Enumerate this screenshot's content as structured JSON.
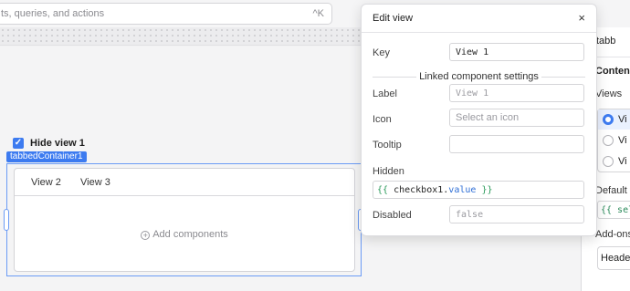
{
  "search": {
    "placeholder": "ts, queries, and actions",
    "shortcut": "^K"
  },
  "canvas": {
    "checkbox": {
      "label": "Hide view 1",
      "checked": true
    },
    "component_tag": "tabbedContainer1",
    "tabs": [
      "View 2",
      "View 3"
    ],
    "add_components": "Add components"
  },
  "inspector": {
    "title": "tabb",
    "content_section": "Content",
    "views_label": "Views",
    "views": [
      {
        "label": "Vi",
        "selected": true
      },
      {
        "label": "Vi",
        "selected": false
      },
      {
        "label": "Vi",
        "selected": false
      }
    ],
    "default_label": "Default v",
    "default_code": "{{ self",
    "addons_label": "Add-ons",
    "header_button": "Heade"
  },
  "edit_view": {
    "title": "Edit view",
    "close": "×",
    "key_label": "Key",
    "key_value": "View 1",
    "linked_heading": "Linked component settings",
    "label_label": "Label",
    "label_placeholder": "View 1",
    "icon_label": "Icon",
    "icon_placeholder": "Select an icon",
    "tooltip_label": "Tooltip",
    "tooltip_value": "",
    "hidden_label": "Hidden",
    "hidden_code": {
      "open": "{{",
      "ident": "checkbox1",
      "dot": ".",
      "prop": "value",
      "close": "}}"
    },
    "disabled_label": "Disabled",
    "disabled_placeholder": "false"
  },
  "colors": {
    "accent": "#3d7bf0",
    "code_brace": "#2a9a5a",
    "code_prop": "#2f6fd6"
  }
}
